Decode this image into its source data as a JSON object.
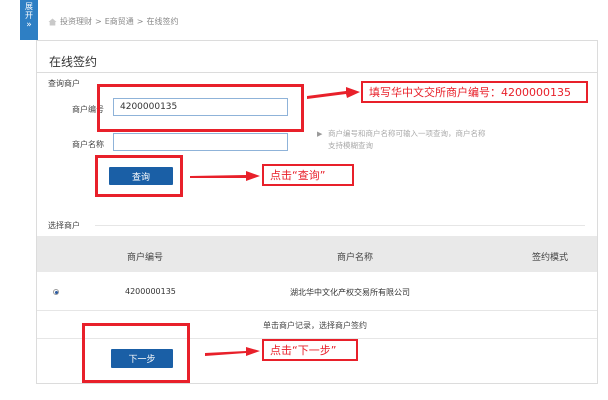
{
  "side_tab": {
    "label_top": "展",
    "label_bottom": "开",
    "chevron": "»"
  },
  "breadcrumb": {
    "icon": "home-icon",
    "items": [
      "投资理财",
      "E商贸通",
      "在线签约"
    ],
    "separator": ">"
  },
  "page_title": "在线签约",
  "query_section": {
    "title": "查询商户",
    "merchant_no_label": "商户编号",
    "merchant_no_value": "4200000135",
    "merchant_name_label": "商户名称",
    "merchant_name_value": "",
    "hint_line1": "商户编号和商户名称可输入一项查询，商户名称",
    "hint_line2": "支持模糊查询",
    "query_button": "查询"
  },
  "select_section": {
    "title": "选择商户",
    "columns": [
      "商户编号",
      "商户名称",
      "签约模式"
    ],
    "rows": [
      {
        "selected": true,
        "merchant_no": "4200000135",
        "merchant_name": "湖北华中文化产权交易所有限公司",
        "mode": ""
      }
    ],
    "footer_note": "单击商户记录，选择商户签约",
    "next_button": "下一步"
  },
  "annotations": {
    "callout_1": "填写华中文交所商户编号：4200000135",
    "callout_2": "点击“查询”",
    "callout_3": "点击“下一步”",
    "color": "#e8202a"
  },
  "colors": {
    "accent": "#1a5fa6",
    "side_tab": "#2e7fc4",
    "annotation": "#e8202a"
  }
}
